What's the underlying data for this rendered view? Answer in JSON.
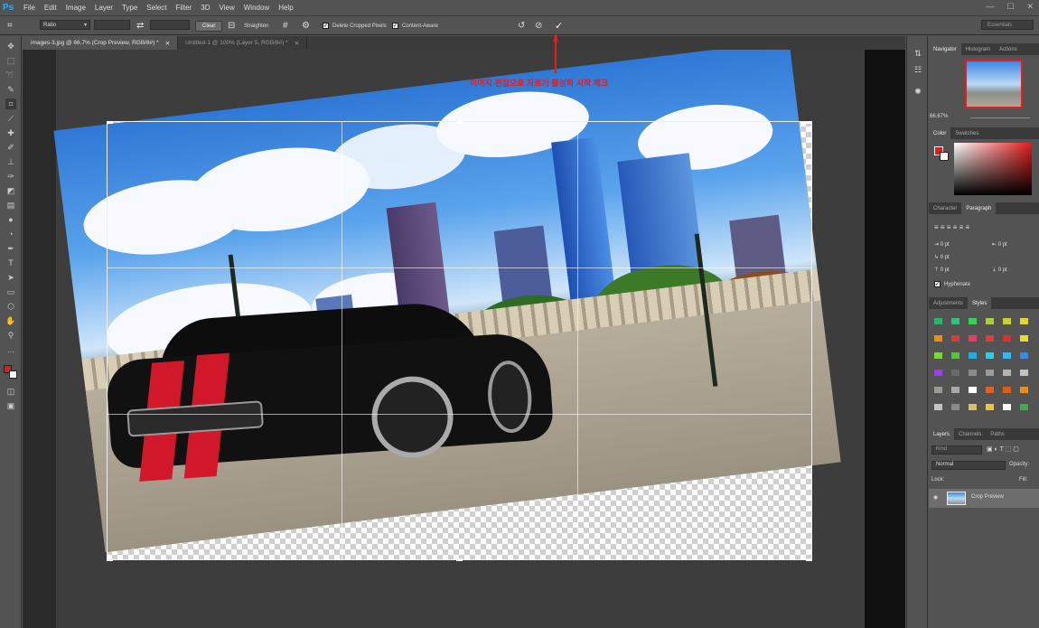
{
  "app": {
    "logo": "Ps"
  },
  "menu": [
    "File",
    "Edit",
    "Image",
    "Layer",
    "Type",
    "Select",
    "Filter",
    "3D",
    "View",
    "Window",
    "Help"
  ],
  "window_controls": [
    "—",
    "☐",
    "✕"
  ],
  "options": {
    "ratio": "Ratio",
    "clear": "Clear",
    "straighten": "Straighten",
    "delete_cropped": "Delete Cropped Pixels",
    "content_aware": "Content-Aware",
    "workspace": "Essentials",
    "undo_icon": "rotate-left-icon",
    "cancel_icon": "cancel-icon",
    "commit_icon": "checkmark-icon"
  },
  "tabs": [
    {
      "label": "images-3.jpg @ 66.7% (Crop Preview, RGB/8#) *",
      "active": true
    },
    {
      "label": "Untitled-1 @ 100% (Layer 5, RGB/8#) *",
      "active": false
    }
  ],
  "annotation": {
    "text": "이미지 편집으로 자르기 활성화 시작 체크",
    "color": "#e31e1e"
  },
  "navigator": {
    "tabs": [
      "Navigator",
      "Histogram",
      "Actions"
    ],
    "zoom": "66.67%"
  },
  "color_panel": {
    "tabs": [
      "Color",
      "Swatches"
    ],
    "fg": "#e11b1b",
    "bg": "#ffffff"
  },
  "paragraph": {
    "tabs": [
      "Character",
      "Paragraph"
    ],
    "fields": [
      "0 pt",
      "0 pt",
      "0 pt",
      "0 pt",
      "0 pt"
    ],
    "hyphenate": "Hyphenate"
  },
  "styles": {
    "tabs": [
      "Adjustments",
      "Styles"
    ],
    "colors": [
      "#2fb36a",
      "#2fc27a",
      "#3fcc5f",
      "#a7d23a",
      "#c8d13a",
      "#e8d330",
      "#e28f1c",
      "#e23a2e",
      "#e63b6b",
      "#e43b3b",
      "#d9322e",
      "#eeda29",
      "#7fd33f",
      "#59c43a",
      "#2aa8d9",
      "#37c9e6",
      "#3bb6e8",
      "#3b87e6",
      "#9b3ee6",
      "#6a6a6a",
      "#8a8a8a",
      "#9a9a9a",
      "#b4b4b4",
      "#c2c2c2",
      "#9a9a9a",
      "#a8a8a8",
      "#ffffff",
      "#e85f1c",
      "#d85e1a",
      "#f08a1e",
      "#c4c4c4",
      "#8a8a8a",
      "#d4c06a",
      "#f2c23a",
      "#ffffff",
      "#2fb34a"
    ]
  },
  "layers": {
    "tabs": [
      "Layers",
      "Channels",
      "Paths"
    ],
    "kind": "Kind",
    "blend": "Normal",
    "opacity_label": "Opacity:",
    "lock_label": "Lock:",
    "fill_label": "Fill:",
    "layer_name": "Crop Preview"
  }
}
